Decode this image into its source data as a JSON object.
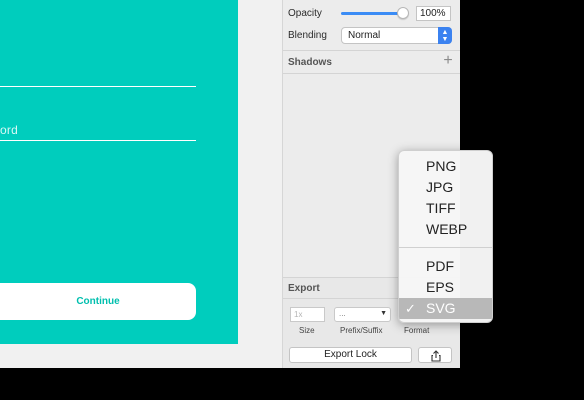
{
  "artboard": {
    "password_text": "ord",
    "continue_label": "Continue"
  },
  "appearance": {
    "opacity_label": "Opacity",
    "opacity_value": "100%",
    "opacity_level": 1.0,
    "blending_label": "Blending",
    "blending_value": "Normal"
  },
  "shadows": {
    "title": "Shadows"
  },
  "export": {
    "title": "Export",
    "size_placeholder": "1x",
    "prefix_value": "...",
    "size_label": "Size",
    "prefix_label": "Prefix/Suffix",
    "format_label": "Format",
    "export_lock_label": "Export Lock"
  },
  "format_menu": {
    "items": [
      "PNG",
      "JPG",
      "TIFF",
      "WEBP"
    ],
    "items2": [
      "PDF",
      "EPS",
      "SVG"
    ],
    "selected": "SVG",
    "check": "✓"
  },
  "colors": {
    "artboard": "#00cdbd",
    "accent": "#3b82f0"
  },
  "icons": [
    "plus-icon",
    "share-icon",
    "chevron-up-down-icon",
    "checkmark-icon"
  ]
}
